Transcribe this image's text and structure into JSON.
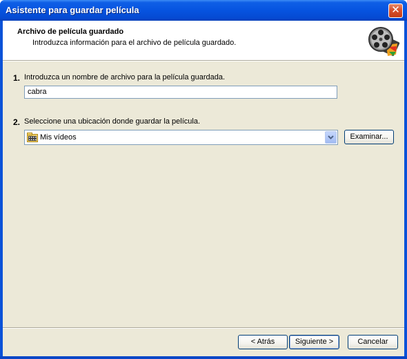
{
  "window": {
    "title": "Asistente para guardar película",
    "close_glyph": "✕"
  },
  "header": {
    "title": "Archivo de película guardado",
    "subtitle": "Introduzca información para el archivo de película guardado.",
    "icon": "film-reel-icon"
  },
  "step1": {
    "number": "1.",
    "label": "Introduzca un nombre de archivo para la película guardada.",
    "filename_value": "cabra"
  },
  "step2": {
    "number": "2.",
    "label": "Seleccione una ubicación donde guardar la película.",
    "location_value": "Mis vídeos",
    "location_icon": "video-folder-icon",
    "browse_label": "Examinar..."
  },
  "buttons": {
    "back_label": "< Atrás",
    "next_label": "Siguiente >",
    "cancel_label": "Cancelar"
  },
  "colors": {
    "titlebar": "#0654e0",
    "dialog_bg": "#ece9d8",
    "close_button": "#d9512d"
  }
}
